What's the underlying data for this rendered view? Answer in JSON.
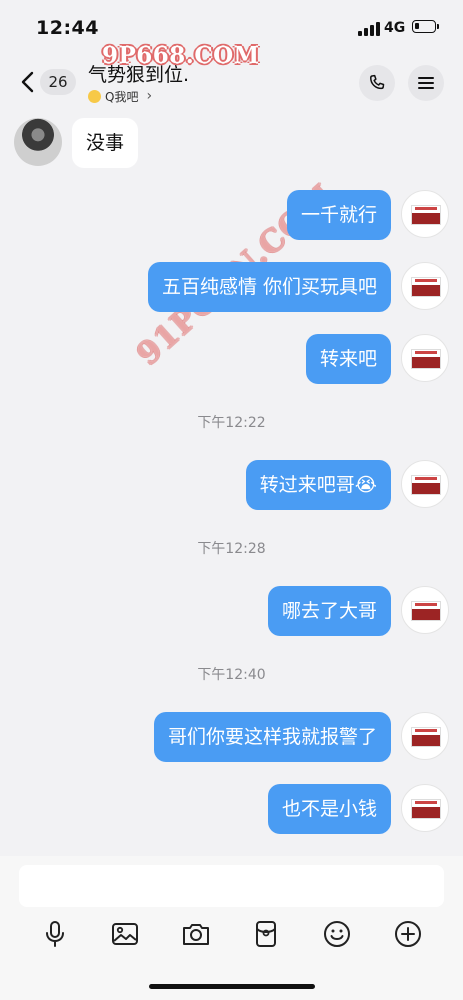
{
  "status_bar": {
    "time": "12:44",
    "network": "4G",
    "battery_level": 0.2
  },
  "header": {
    "unread_count": "26",
    "title": "气势狠到位.",
    "subtitle": "Q我吧",
    "back_icon": "chevron-left-icon",
    "call_icon": "phone-icon",
    "menu_icon": "menu-icon"
  },
  "watermarks": {
    "top": "9P668.COM",
    "diagonal": "91PORN.COM"
  },
  "messages": [
    {
      "side": "left",
      "text": "没事"
    },
    {
      "side": "right",
      "text": "一千就行"
    },
    {
      "side": "right",
      "text": "五百纯感情 你们买玩具吧"
    },
    {
      "side": "right",
      "text": "转来吧"
    },
    {
      "side": "right",
      "text": "转过来吧哥😭"
    },
    {
      "side": "right",
      "text": "哪去了大哥"
    },
    {
      "side": "right",
      "text": "哥们你要这样我就报警了"
    },
    {
      "side": "right",
      "text": "也不是小钱"
    }
  ],
  "timestamps": [
    "下午12:22",
    "下午12:28",
    "下午12:40"
  ],
  "input": {
    "placeholder": "",
    "value": ""
  },
  "toolbar": [
    "microphone-icon",
    "image-icon",
    "camera-icon",
    "red-packet-icon",
    "emoji-icon",
    "plus-icon"
  ],
  "colors": {
    "bubble_sent": "#4a9cf3",
    "bubble_received": "#ffffff",
    "background": "#f2f2f4"
  }
}
